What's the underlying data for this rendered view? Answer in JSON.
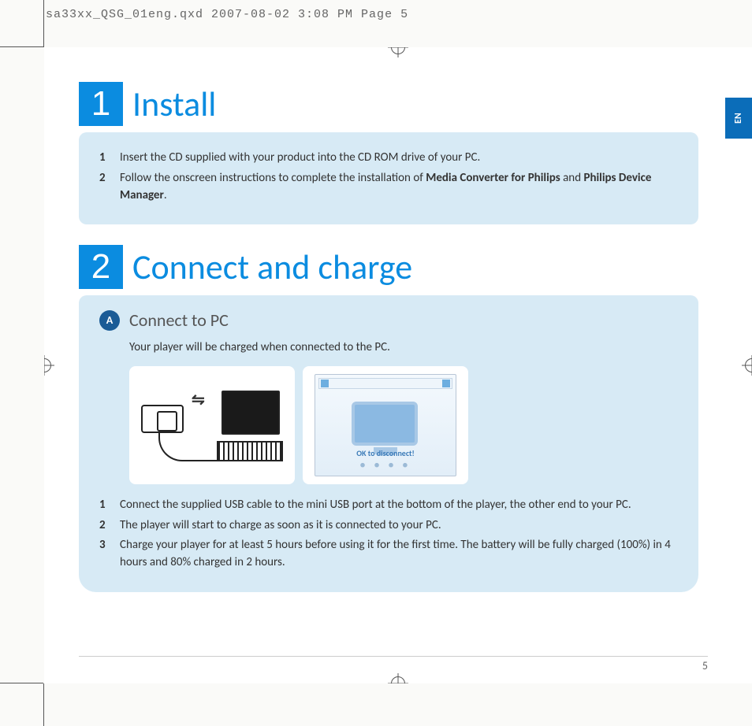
{
  "print_header": "sa33xx_QSG_01eng.qxd  2007-08-02  3:08 PM  Page 5",
  "lang_tab": "EN",
  "section1": {
    "num": "1",
    "title": "Install",
    "steps": [
      {
        "n": "1",
        "text": "Insert the CD supplied with your product into the CD ROM drive of your PC."
      },
      {
        "n": "2",
        "text_pre": "Follow the onscreen instructions to complete the installation of ",
        "bold1": "Media Converter for Philips",
        "mid": " and ",
        "bold2": "Philips Device Manager",
        "post": "."
      }
    ]
  },
  "section2": {
    "num": "2",
    "title": "Connect and charge",
    "sub": {
      "letter": "A",
      "title": "Connect to PC",
      "intro": "Your player will be charged when connected to the PC.",
      "screenshot_text": "OK to disconnect!",
      "steps": [
        {
          "n": "1",
          "text": "Connect the supplied USB cable to the mini USB port at the bottom of the player, the other end to your PC."
        },
        {
          "n": "2",
          "text": "The player will start to charge as soon as it is connected to your PC."
        },
        {
          "n": "3",
          "text": "Charge your player for at least 5 hours before using it for the first time. The battery will be fully charged (100%) in 4 hours and 80% charged in 2 hours."
        }
      ]
    }
  },
  "page_number": "5"
}
